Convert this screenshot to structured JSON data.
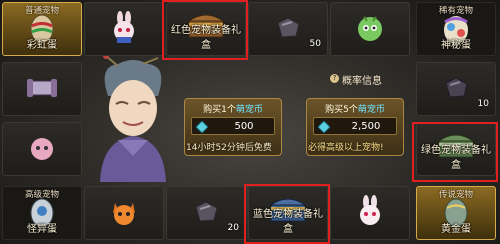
{
  "top_row": {
    "colorful_egg": {
      "tag": "普通宠物",
      "label": "彩虹蛋"
    },
    "red_box": {
      "label": "红色宠物装备礼盒"
    },
    "stone_count": "50",
    "mystery_egg": {
      "tag": "稀有宠物",
      "label": "神秘蛋"
    }
  },
  "probability": {
    "label": "概率信息"
  },
  "middle": {
    "scroll_count": "10",
    "green_box": {
      "label": "绿色宠物装备礼盒"
    }
  },
  "offers": {
    "buy_one": {
      "prefix": "购买1个",
      "highlight": "萌宠币",
      "price": "500",
      "note": "14小时52分钟后免费"
    },
    "buy_five": {
      "prefix": "购买5个",
      "highlight": "萌宠币",
      "price": "2,500",
      "note": "必得高级以上宠物!"
    }
  },
  "bottom_row": {
    "strange_egg": {
      "tag": "高级宠物",
      "label": "怪异蛋"
    },
    "stone_count": "20",
    "blue_box": {
      "label": "蓝色宠物装备礼盒"
    },
    "gold_egg": {
      "tag": "传说宠物",
      "label": "黄金蛋"
    }
  },
  "colors": {
    "highlight_border": "#e02020",
    "accent_cyan": "#6fe2ff",
    "gold": "#d6ad48"
  }
}
